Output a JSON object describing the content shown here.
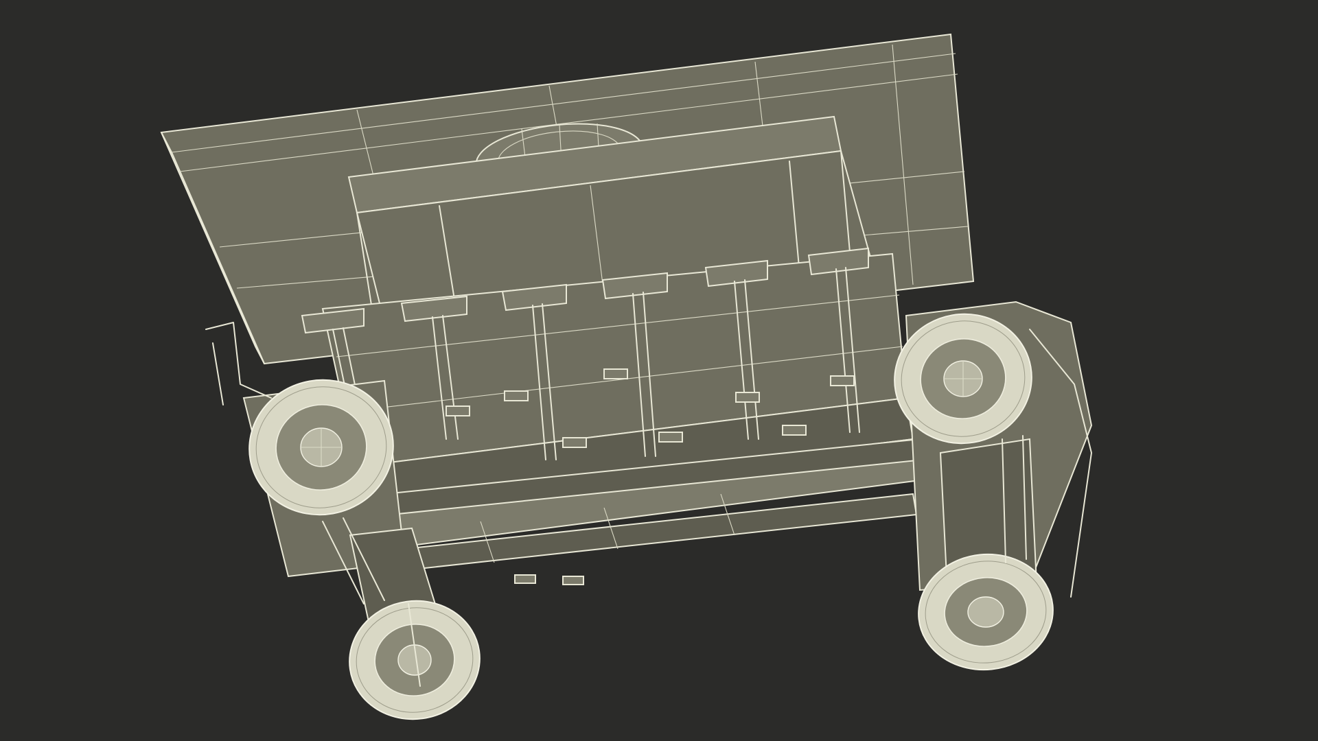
{
  "scene": {
    "subject": "wireframe-3d-model",
    "background_color": "#2b2b29",
    "wire_color": "#e9e8d6",
    "surface_color": "#6f6e5f",
    "tire_color": "#d9d8c5"
  }
}
